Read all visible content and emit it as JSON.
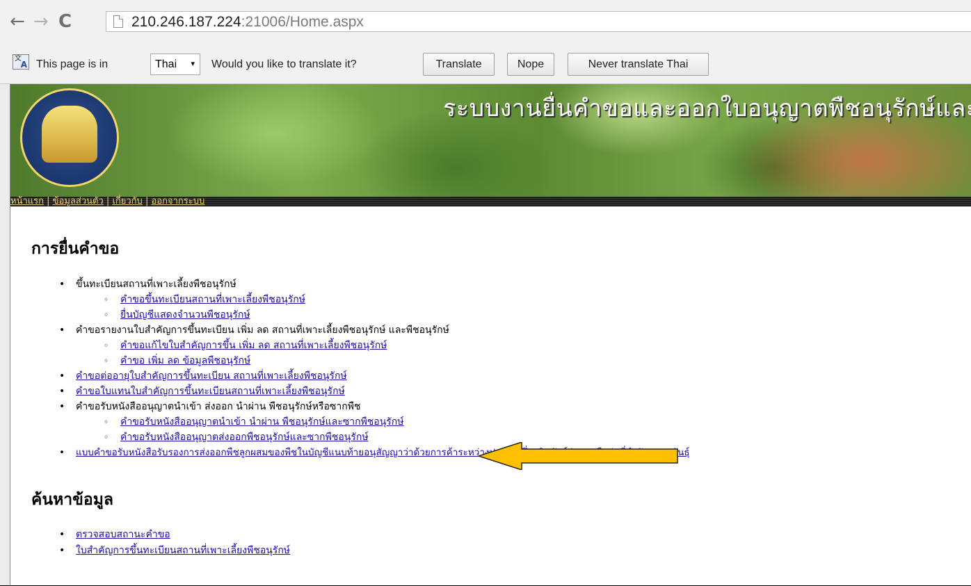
{
  "browser": {
    "nav": {
      "back": "←",
      "forward": "→",
      "reload": "C"
    },
    "url_host": "210.246.187.224",
    "url_rest": ":21006/Home.aspx"
  },
  "translate_bar": {
    "text_before": "This page is in",
    "language": "Thai",
    "text_after": "Would you like to translate it?",
    "translate_label": "Translate",
    "nope_label": "Nope",
    "never_label": "Never translate Thai"
  },
  "header": {
    "title": "ระบบงานยื่นคำขอและออกใบอนุญาตพืชอนุรักษ์และซา",
    "nav": [
      "หน้าแรก",
      "ข้อมูลส่วนตัว",
      "เกี่ยวกับ",
      "ออกจากระบบ"
    ],
    "nav_separator": "|"
  },
  "sections": {
    "request": {
      "title": "การยื่นคำขอ",
      "items": [
        "ขึ้นทะเบียนสถานที่เพาะเลี้ยงพืชอนุรักษ์",
        "คำขอขึ้นทะเบียนสถานที่เพาะเลี้ยงพืชอนุรักษ์",
        "ยื่นบัญชีแสดงจำนวนพืชอนุรักษ์",
        "คำขอรายงานใบสำคัญการขึ้นทะเบียน เพิ่ม ลด สถานที่เพาะเลี้ยงพืชอนุรักษ์ และพืชอนุรักษ์",
        "คำขอแก้ไขใบสำคัญการขึ้น เพิ่ม ลด สถานที่เพาะเลี้ยงพืชอนุรักษ์",
        "คำขอ เพิ่ม ลด ข้อมูลพืชอนุรักษ์",
        "คำขอต่ออายุใบสำคัญการขึ้นทะเบียน สถานที่เพาะเลี้ยงพืชอนุรักษ์",
        "คำขอใบแทนใบสำคัญการขึ้นทะเบียนสถานที่เพาะเลี้ยงพืชอนุรักษ์",
        "คำขอรับหนังสืออนุญาตนำเข้า ส่งออก นำผ่าน พืชอนุรักษ์หรือซากพืช",
        "คำขอรับหนังสืออนุญาตนำเข้า นำผ่าน พืชอนุรักษ์และซากพืชอนุรักษ์",
        "คำขอรับหนังสืออนุญาตส่งออกพืชอนุรักษ์และซากพืชอนุรักษ์",
        "แบบคำขอรับหนังสือรับรองการส่งออกพืชลูกผสมของพืชในบัญชีแนบท้ายอนุสัญญาว่าด้วยการค้าระหว่างประเทศซึ่งชนิดสัตว์ป่าและพืชป่าที่กำลังจะสูญพันธุ์"
      ]
    },
    "search": {
      "title": "ค้นหาข้อมูล",
      "items": [
        "ตรวจสอบสถานะคำขอ",
        "ใบสำคัญการขึ้นทะเบียนสถานที่เพาะเลี้ยงพืชอนุรักษ์"
      ]
    }
  },
  "glyphs": {
    "bullet": "•",
    "sub_bullet": "◦",
    "caret": "▾"
  },
  "colors": {
    "link": "#1a0dab",
    "nav_link": "#f2d27a",
    "arrow_fill": "#ffc000"
  },
  "icons": {
    "translate": "translate-icon",
    "page": "page-icon",
    "arrow": "yellow-arrow-annotation"
  }
}
